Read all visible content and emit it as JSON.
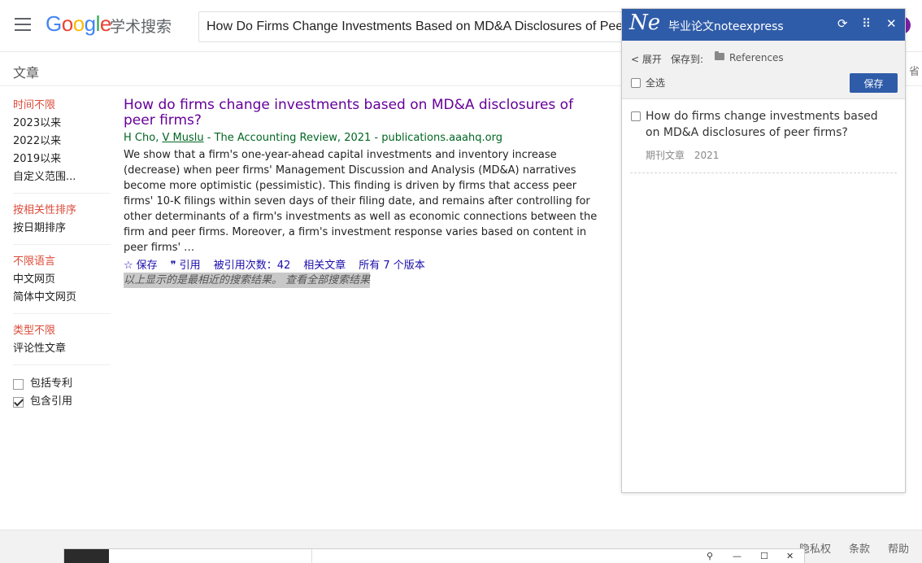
{
  "header": {
    "logo_google": "Google",
    "logo_sub": "学术搜索",
    "search_value": "How Do Firms Change Investments Based on MD&A Disclosures of Peer Firms?"
  },
  "subheader": {
    "title": "文章",
    "right_partial": "省"
  },
  "sidebar": {
    "time": [
      "时间不限",
      "2023以来",
      "2022以来",
      "2019以来",
      "自定义范围..."
    ],
    "sort": [
      "按相关性排序",
      "按日期排序"
    ],
    "language": [
      "不限语言",
      "中文网页",
      "简体中文网页"
    ],
    "type": [
      "类型不限",
      "评论性文章"
    ],
    "checks": [
      {
        "label": "包括专利",
        "checked": false
      },
      {
        "label": "包含引用",
        "checked": true
      }
    ]
  },
  "result": {
    "title": "How do firms change investments based on MD&A disclosures of peer firms?",
    "author1": "H Cho",
    "author_sep": ", ",
    "author2": "V Muslu",
    "meta_rest": " - The Accounting Review, 2021 - publications.aaahq.org",
    "snippet": "We show that a firm's one-year-ahead capital investments and inventory increase (decrease) when peer firms' Management Discussion and Analysis (MD&A) narratives become more optimistic (pessimistic). This finding is driven by firms that access peer firms' 10-K filings within seven days of their filing date, and remains after controlling for other determinants of a firm's investments as well as economic connections between the firm and peer firms. Moreover, a firm's investment response varies based on content in peer firms' …",
    "actions": {
      "save": "保存",
      "cite": "引用",
      "cited_by": "被引用次数：42",
      "related": "相关文章",
      "versions": "所有 7 个版本"
    }
  },
  "notice": "以上显示的是最相近的搜索结果。 查看全部搜索结果",
  "footer": {
    "privacy": "隐私权",
    "terms": "条款",
    "help": "帮助"
  },
  "ne_panel": {
    "logo": "Ne",
    "title": "毕业论文noteexpress",
    "expand": "< 展开",
    "save_to": "保存到:",
    "folder": "References",
    "select_all": "全选",
    "save_button": "保存",
    "item_title": "How do firms change investments based on MD&A disclosures of peer firms?",
    "item_type": "期刊文章",
    "item_year": "2021"
  },
  "colors": {
    "ne_blue": "#2f5ca8",
    "link_purple": "#660099",
    "green_meta": "#006621",
    "active_red": "#dd4b39"
  }
}
